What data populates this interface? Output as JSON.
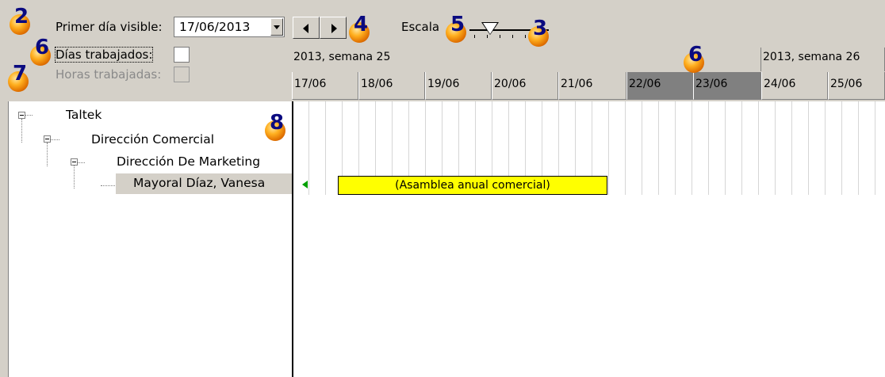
{
  "toolbar": {
    "primer_label": "Primer día visible:",
    "date_value": "17/06/2013",
    "escala_label": "Escala",
    "prev_icon": "arrow-left-icon",
    "next_icon": "arrow-right-icon"
  },
  "options": {
    "dias_label": "Días trabajados:",
    "horas_label": "Horas trabajadas:",
    "dias_checked": false,
    "horas_checked": false,
    "horas_enabled": false
  },
  "timeline": {
    "weeks": [
      "2013, semana 25",
      "2013, semana 26"
    ],
    "days": [
      "17/06",
      "18/06",
      "19/06",
      "20/06",
      "21/06",
      "22/06",
      "23/06",
      "24/06",
      "25/06"
    ],
    "weekend_color": "#808080"
  },
  "tree": {
    "nodes": [
      "Taltek",
      "Dirección Comercial",
      "Dirección De Marketing",
      "Mayoral Díaz, Vanesa"
    ]
  },
  "task": {
    "label": "(Asamblea anual comercial)",
    "color": "#ffff00"
  },
  "callouts": {
    "c2": "2",
    "c6a": "6",
    "c7": "7",
    "c4": "4",
    "c5": "5",
    "c3": "3",
    "c6b": "6",
    "c8": "8"
  }
}
